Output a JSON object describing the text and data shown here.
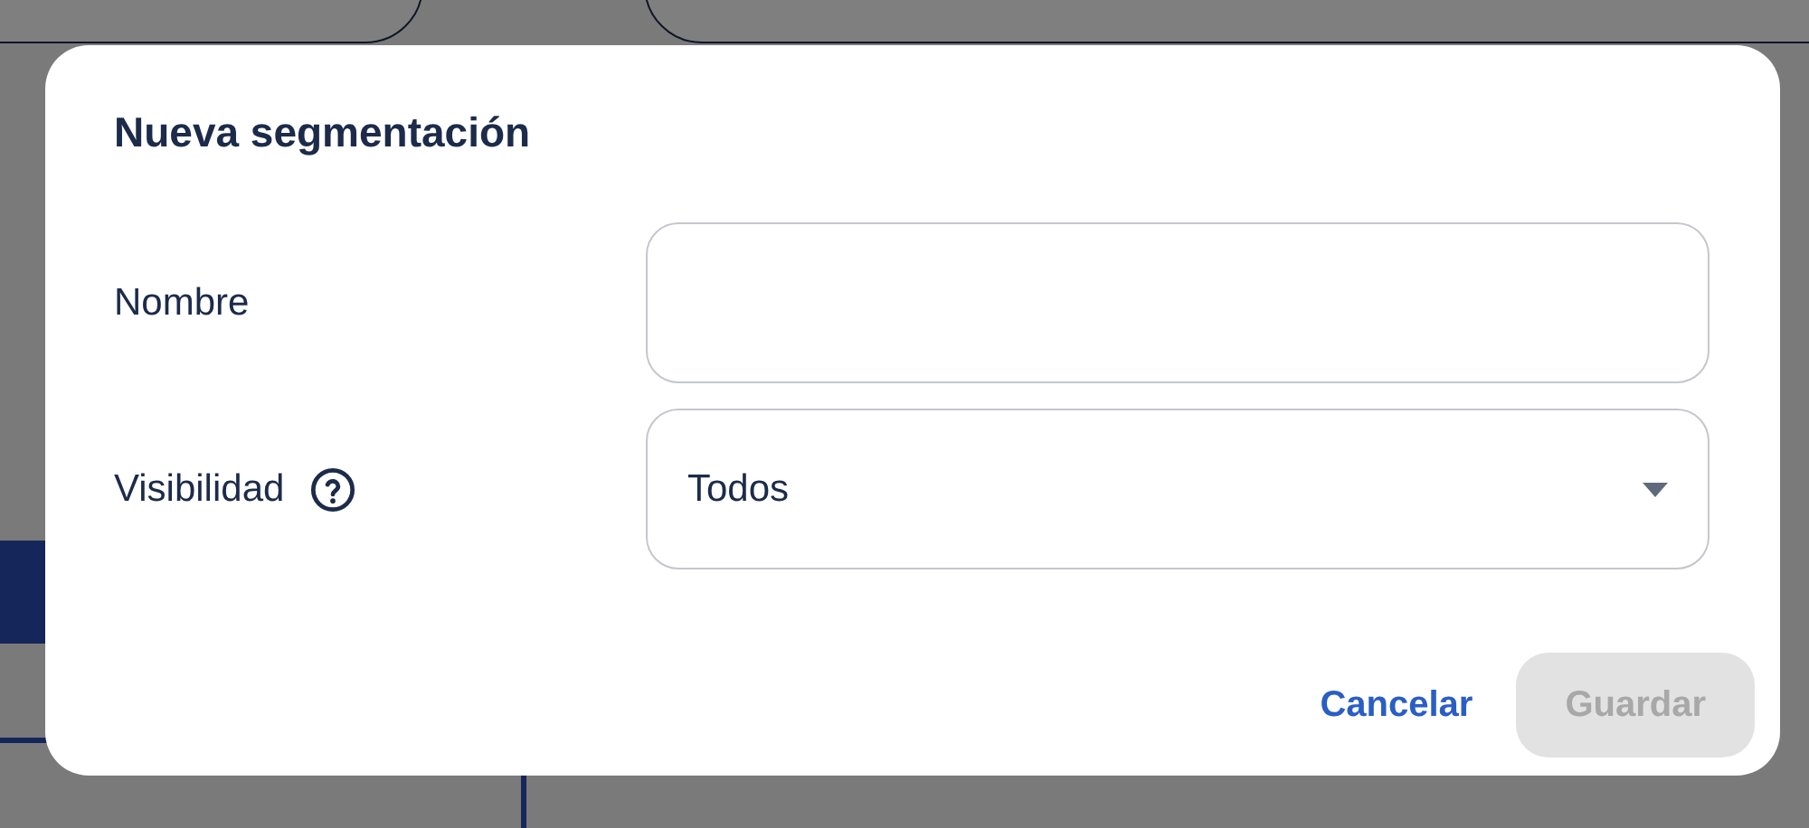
{
  "dialog": {
    "title": "Nueva segmentación",
    "fields": [
      {
        "kind": "text",
        "label": "Nombre"
      },
      {
        "kind": "select",
        "label": "Visibilidad",
        "help": true,
        "value": "Todos"
      }
    ],
    "buttons": [
      {
        "kind": "text",
        "label": "Cancelar",
        "disabled": false
      },
      {
        "kind": "filled",
        "label": "Guardar",
        "disabled": true
      }
    ]
  }
}
